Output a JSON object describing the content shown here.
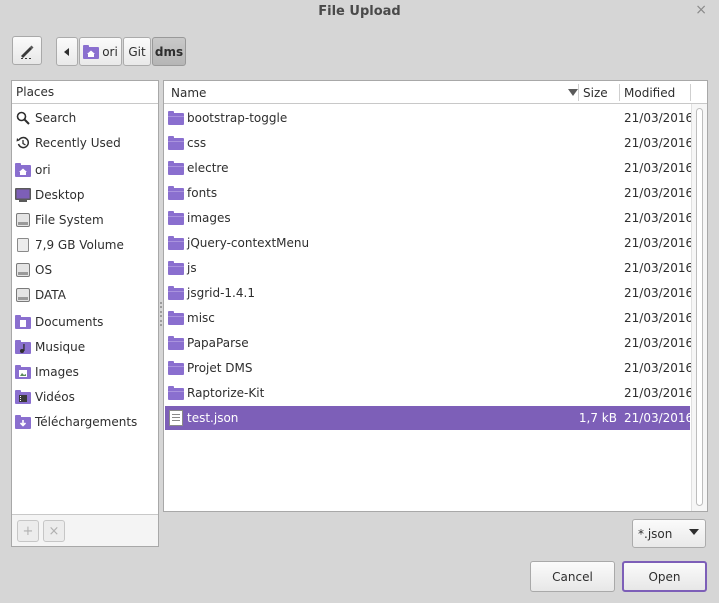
{
  "window": {
    "title": "File Upload",
    "close_glyph": "×"
  },
  "breadcrumb": {
    "home_label": "ori",
    "items": [
      "Git",
      "dms"
    ]
  },
  "places": {
    "header": "Places",
    "items": [
      {
        "label": "Search",
        "icon": "search-icon"
      },
      {
        "label": "Recently Used",
        "icon": "recent-icon"
      },
      {
        "label": "ori",
        "icon": "home-folder-icon"
      },
      {
        "label": "Desktop",
        "icon": "desktop-icon"
      },
      {
        "label": "File System",
        "icon": "drive-icon"
      },
      {
        "label": "7,9 GB Volume",
        "icon": "volume-icon"
      },
      {
        "label": "OS",
        "icon": "drive-icon"
      },
      {
        "label": "DATA",
        "icon": "drive-icon"
      },
      {
        "label": "Documents",
        "icon": "documents-folder-icon"
      },
      {
        "label": "Musique",
        "icon": "music-folder-icon"
      },
      {
        "label": "Images",
        "icon": "pictures-folder-icon"
      },
      {
        "label": "Vidéos",
        "icon": "videos-folder-icon"
      },
      {
        "label": "Téléchargements",
        "icon": "downloads-folder-icon"
      }
    ],
    "add_glyph": "+",
    "remove_glyph": "×"
  },
  "file_list": {
    "columns": {
      "name": "Name",
      "size": "Size",
      "modified": "Modified"
    },
    "rows": [
      {
        "name": "bootstrap-toggle",
        "size": "",
        "modified": "21/03/2016",
        "type": "folder"
      },
      {
        "name": "css",
        "size": "",
        "modified": "21/03/2016",
        "type": "folder"
      },
      {
        "name": "electre",
        "size": "",
        "modified": "21/03/2016",
        "type": "folder"
      },
      {
        "name": "fonts",
        "size": "",
        "modified": "21/03/2016",
        "type": "folder"
      },
      {
        "name": "images",
        "size": "",
        "modified": "21/03/2016",
        "type": "folder"
      },
      {
        "name": "jQuery-contextMenu",
        "size": "",
        "modified": "21/03/2016",
        "type": "folder"
      },
      {
        "name": "js",
        "size": "",
        "modified": "21/03/2016",
        "type": "folder"
      },
      {
        "name": "jsgrid-1.4.1",
        "size": "",
        "modified": "21/03/2016",
        "type": "folder"
      },
      {
        "name": "misc",
        "size": "",
        "modified": "21/03/2016",
        "type": "folder"
      },
      {
        "name": "PapaParse",
        "size": "",
        "modified": "21/03/2016",
        "type": "folder"
      },
      {
        "name": "Projet DMS",
        "size": "",
        "modified": "21/03/2016",
        "type": "folder"
      },
      {
        "name": "Raptorize-Kit",
        "size": "",
        "modified": "21/03/2016",
        "type": "folder"
      },
      {
        "name": "test.json",
        "size": "1,7 kB",
        "modified": "21/03/2016",
        "type": "file",
        "selected": true
      }
    ]
  },
  "filter": {
    "value": "*.json"
  },
  "buttons": {
    "cancel": "Cancel",
    "open": "Open"
  },
  "colors": {
    "accent": "#7d5fb8",
    "folder": "#8a6fcf",
    "background": "#d6d6d6"
  }
}
